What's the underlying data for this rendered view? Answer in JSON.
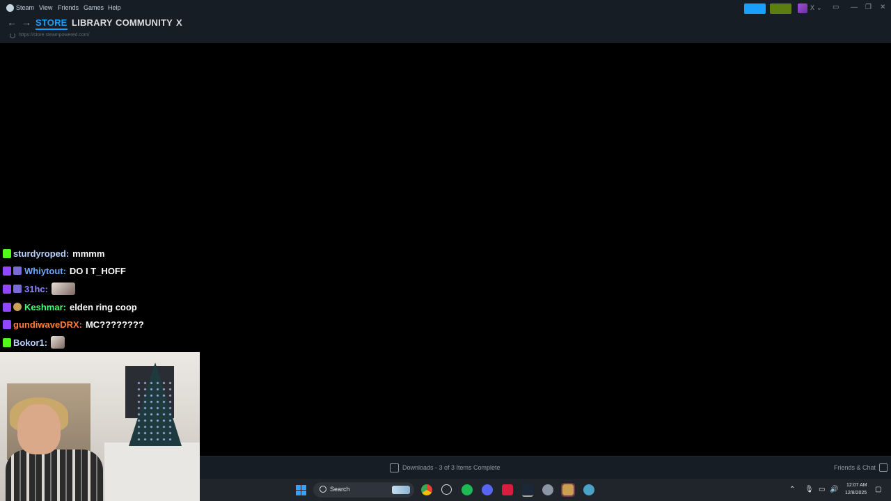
{
  "steam": {
    "menu": [
      "Steam",
      "View",
      "Friends",
      "Games",
      "Help"
    ],
    "account_name": "X",
    "account_caret": "⌄"
  },
  "nav": {
    "back": "←",
    "forward": "→",
    "tabs": [
      "STORE",
      "LIBRARY",
      "COMMUNITY",
      "X"
    ],
    "active_tab": "STORE",
    "url": "https://store.steampowered.com/"
  },
  "chat": [
    {
      "platform": "kick",
      "user": "sturdyroped:",
      "message": "mmmm",
      "user_color": "#b9d3ff"
    },
    {
      "platform": "twitch",
      "user": "Whiytout:",
      "message": "DO I T_HOFF",
      "user_color": "#6fa7ff"
    },
    {
      "platform": "twitch",
      "user": "31hc:",
      "message": "",
      "emote": true,
      "user_color": "#8f86ff"
    },
    {
      "platform": "twitch",
      "user": "Keshmar:",
      "message": "elden ring coop",
      "user_color": "#47ff72"
    },
    {
      "platform": "twitch",
      "user": "gundiwaveDRX:",
      "message": "MC????????",
      "user_color": "#ff7e3b"
    },
    {
      "platform": "kick",
      "user": "Bokor1:",
      "message": "",
      "emote": true,
      "user_color": "#b9d3ff"
    }
  ],
  "bottom_bar": {
    "downloads": "Downloads - 3 of 3 Items Complete",
    "friends": "Friends & Chat"
  },
  "taskbar": {
    "search_label": "Search",
    "time": "12:07 AM",
    "date": "12/8/2025"
  }
}
